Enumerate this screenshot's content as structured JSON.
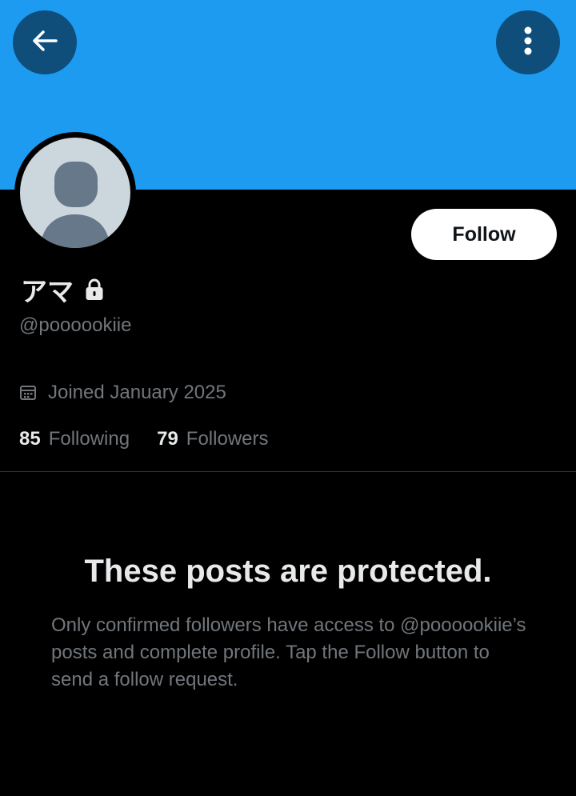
{
  "profile": {
    "display_name": "アマ",
    "handle": "@poooookiie",
    "joined": "Joined January 2025",
    "following_count": "85",
    "following_label": "Following",
    "followers_count": "79",
    "followers_label": "Followers"
  },
  "actions": {
    "follow_label": "Follow",
    "back_icon": "arrow-left-icon",
    "more_icon": "more-vertical-icon"
  },
  "protected": {
    "title": "These posts are protected.",
    "body": "Only confirmed followers have access to @poooookiie’s posts and complete profile. Tap the Follow button to send a follow request."
  },
  "colors": {
    "banner": "#1d9bf0",
    "background": "#000000",
    "primary_text": "#e7e9ea",
    "secondary_text": "#71767b",
    "follow_button_bg": "#ffffff"
  }
}
